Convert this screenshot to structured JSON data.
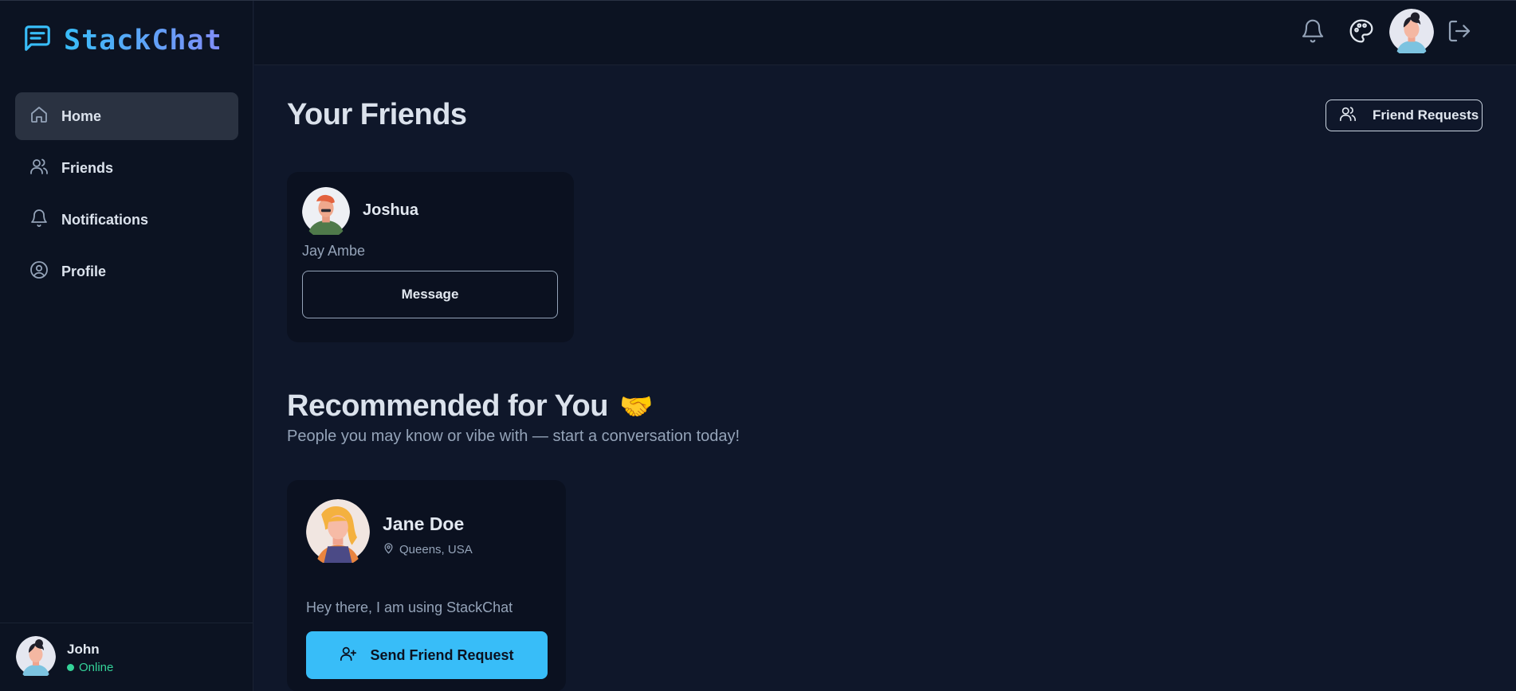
{
  "app": {
    "name": "StackChat"
  },
  "sidebar": {
    "items": [
      {
        "label": "Home",
        "icon": "home-icon",
        "active": true
      },
      {
        "label": "Friends",
        "icon": "users-icon",
        "active": false
      },
      {
        "label": "Notifications",
        "icon": "bell-icon",
        "active": false
      },
      {
        "label": "Profile",
        "icon": "user-circle-icon",
        "active": false
      }
    ],
    "user": {
      "name": "John",
      "status": "Online"
    }
  },
  "topbar": {
    "icons": [
      "bell-icon",
      "palette-icon",
      "avatar",
      "logout-icon"
    ]
  },
  "main": {
    "title": "Your Friends",
    "friend_requests_label": "Friend Requests",
    "friends": [
      {
        "name": "Joshua",
        "subtitle": "Jay Ambe",
        "button": "Message"
      }
    ],
    "recommended": {
      "title": "Recommended for You",
      "emoji": "🤝",
      "subtitle": "People you may know or vibe with — start a conversation today!",
      "people": [
        {
          "name": "Jane Doe",
          "location": "Queens, USA",
          "bio": "Hey there, I am using StackChat",
          "button": "Send Friend Request"
        }
      ]
    }
  },
  "colors": {
    "accent": "#38bdf8",
    "online": "#34d399",
    "background": "#0f172a"
  }
}
